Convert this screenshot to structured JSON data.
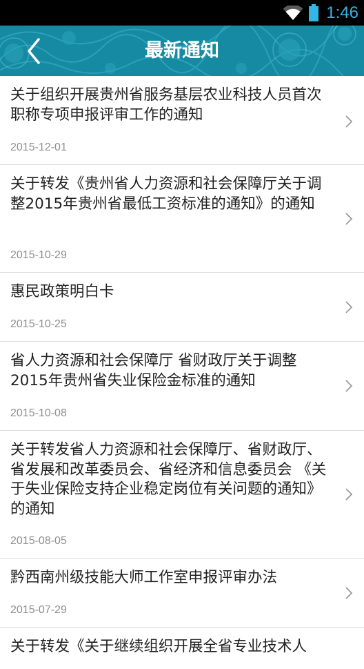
{
  "status_bar": {
    "time": "1:46",
    "icons": [
      "wifi-icon",
      "battery-icon"
    ],
    "accent_color": "#33b5e5"
  },
  "header": {
    "title": "最新通知",
    "back_icon": "back-arrow-icon",
    "bg_color": "#168aa3"
  },
  "notices": [
    {
      "title": "关于组织开展贵州省服务基层农业科技人员首次职称专项申报评审工作的通知",
      "date": "2015-12-01"
    },
    {
      "title": "关于转发《贵州省人力资源和社会保障厅关于调整2015年贵州省最低工资标准的通知》的通知",
      "date": "2015-10-29"
    },
    {
      "title": "惠民政策明白卡",
      "date": "2015-10-25"
    },
    {
      "title": "省人力资源和社会保障厅 省财政厅关于调整2015年贵州省失业保险金标准的通知",
      "date": "2015-10-08"
    },
    {
      "title": "关于转发省人力资源和社会保障厅、省财政厅、省发展和改革委员会、省经济和信息委员会 《关于失业保险支持企业稳定岗位有关问题的通知》的通知",
      "date": "2015-08-05"
    },
    {
      "title": "黔西南州级技能大师工作室申报评审办法",
      "date": "2015-07-29"
    },
    {
      "title": "关于转发《关于继续组织开展全省专业技术人",
      "date": ""
    }
  ]
}
